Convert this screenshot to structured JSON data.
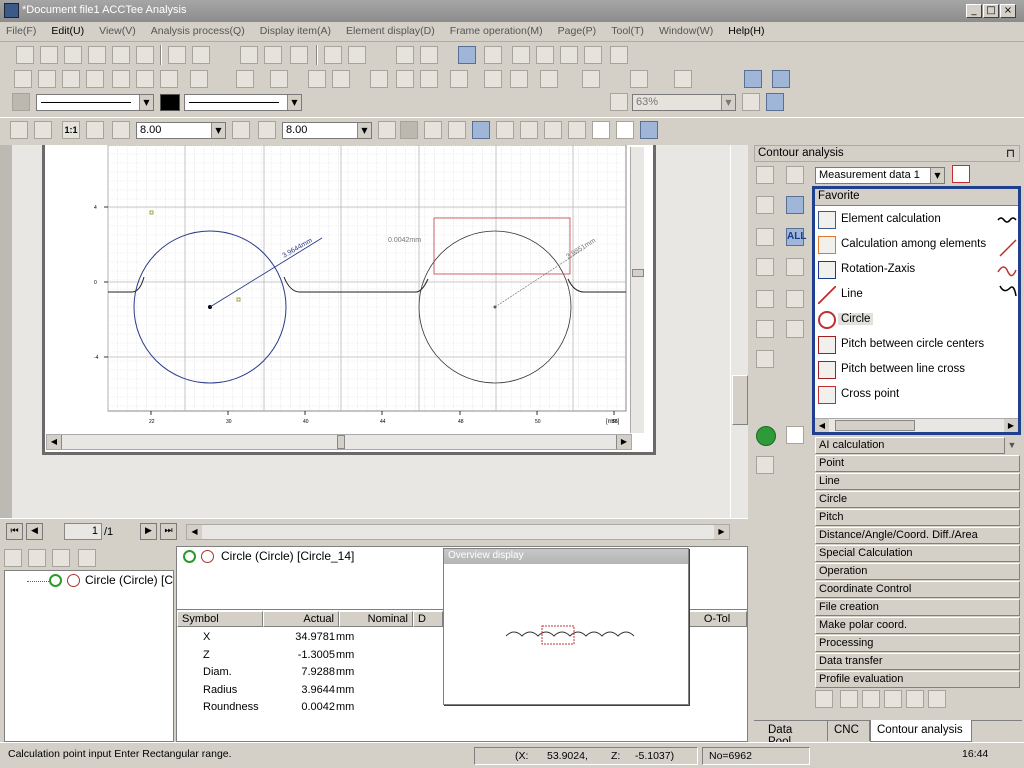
{
  "window": {
    "title": "*Document file1 ACCTee Analysis",
    "min": "_",
    "max": "□",
    "close": "×"
  },
  "menu": [
    {
      "label": "File(F)",
      "on": false
    },
    {
      "label": "Edit(U)",
      "on": true
    },
    {
      "label": "View(V)",
      "on": false
    },
    {
      "label": "Analysis process(Q)",
      "on": false
    },
    {
      "label": "Display item(A)",
      "on": false
    },
    {
      "label": "Element display(D)",
      "on": false
    },
    {
      "label": "Frame operation(M)",
      "on": false
    },
    {
      "label": "Page(P)",
      "on": false
    },
    {
      "label": "Tool(T)",
      "on": false
    },
    {
      "label": "Window(W)",
      "on": false
    },
    {
      "label": "Help(H)",
      "on": true
    }
  ],
  "toolbar": {
    "zoom": "63%",
    "scale_label": "1:1",
    "scale_x": "8.00",
    "scale_z": "8.00"
  },
  "chart_data": {
    "type": "scatter",
    "x_ticks": [
      "22",
      "30",
      "40",
      "44",
      "48",
      "50",
      "56"
    ],
    "y_ticks": [
      "4",
      "0",
      "-4"
    ],
    "x_unit": "[mm]",
    "annotations": [
      "3.9644mm",
      "0.0042mm",
      "3.9851mm"
    ]
  },
  "pager": {
    "page": "1",
    "total": "/1"
  },
  "tree": {
    "item": "Circle (Circle) [Circle_14]"
  },
  "element_header": "Circle (Circle) [Circle_14]",
  "table": {
    "columns": [
      "Symbol",
      "Actual",
      "Nominal",
      "D",
      "O-Tol"
    ],
    "rows": [
      {
        "symbol": "X",
        "actual": "34.9781",
        "unit": "mm"
      },
      {
        "symbol": "Z",
        "actual": "-1.3005",
        "unit": "mm"
      },
      {
        "symbol": "Diam.",
        "actual": "7.9288",
        "unit": "mm"
      },
      {
        "symbol": "Radius",
        "actual": "3.9644",
        "unit": "mm"
      },
      {
        "symbol": "Roundness",
        "actual": "0.0042",
        "unit": "mm"
      }
    ]
  },
  "overview": {
    "title": "Overview display"
  },
  "contour": {
    "title": "Contour analysis",
    "pin": "⊓",
    "measurement": "Measurement data 1",
    "favorite_header": "Favorite",
    "favorites": [
      {
        "label": "Element calculation",
        "icon": "element-calculation-icon"
      },
      {
        "label": "Calculation among elements",
        "icon": "calculation-among-elements-icon"
      },
      {
        "label": "Rotation-Zaxis",
        "icon": "rotation-zaxis-icon"
      },
      {
        "label": "Line",
        "icon": "line-icon"
      },
      {
        "label": "Circle",
        "icon": "circle-icon"
      },
      {
        "label": "Pitch between circle centers",
        "icon": "pitch-circle-icon"
      },
      {
        "label": "Pitch between line cross",
        "icon": "pitch-line-icon"
      },
      {
        "label": "Cross point",
        "icon": "cross-point-icon"
      }
    ],
    "categories": [
      "AI calculation",
      "Point",
      "Line",
      "Circle",
      "Pitch",
      "Distance/Angle/Coord. Diff./Area",
      "Special Calculation",
      "Operation",
      "Coordinate Control",
      "File creation",
      "Make polar coord.",
      "Processing",
      "Data transfer",
      "Profile evaluation"
    ]
  },
  "tabs": [
    "Data Pool",
    "CNC",
    "Contour analysis"
  ],
  "status": {
    "message": "Calculation point input Enter Rectangular range.",
    "x_label": "(X:",
    "x_val": "53.9024,",
    "z_label": "Z:",
    "z_val": "-5.1037)",
    "no": "No=6962",
    "time": "16:44"
  }
}
